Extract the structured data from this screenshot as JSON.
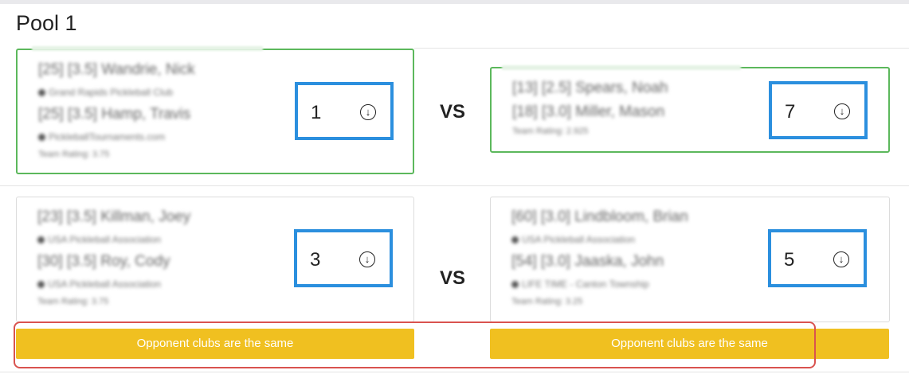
{
  "pool": {
    "title": "Pool 1"
  },
  "matches": [
    {
      "vs_label": "VS",
      "left": {
        "winner": true,
        "players": [
          {
            "name": "[25] [3.5] Wandrie, Nick",
            "club": "Grand Rapids Pickleball Club"
          },
          {
            "name": "[25] [3.5] Hamp, Travis",
            "club": "PickleballTournaments.com"
          }
        ],
        "rating": "Team Rating: 3.75",
        "seed": "1"
      },
      "right": {
        "winner": true,
        "players": [
          {
            "name": "[13] [2.5] Spears, Noah",
            "club": ""
          },
          {
            "name": "[18] [3.0] Miller, Mason",
            "club": ""
          }
        ],
        "rating": "Team Rating: 2.925",
        "seed": "7"
      }
    },
    {
      "vs_label": "VS",
      "left": {
        "winner": false,
        "players": [
          {
            "name": "[23] [3.5] Killman, Joey",
            "club": "USA Pickleball Association"
          },
          {
            "name": "[30] [3.5] Roy, Cody",
            "club": "USA Pickleball Association"
          }
        ],
        "rating": "Team Rating: 3.75",
        "seed": "3",
        "warning": "Opponent clubs are the same"
      },
      "right": {
        "winner": false,
        "players": [
          {
            "name": "[60] [3.0] Lindbloom, Brian",
            "club": "USA Pickleball Association"
          },
          {
            "name": "[54] [3.0] Jaaska, John",
            "club": "LIFE TIME - Canton Township"
          }
        ],
        "rating": "Team Rating: 3.25",
        "seed": "5",
        "warning": "Opponent clubs are the same"
      }
    }
  ],
  "icons": {
    "download": "arrow-circle-down-icon"
  },
  "colors": {
    "winner_border": "#5cb85c",
    "seed_border": "#2b8fde",
    "warning_bg": "#f0c020",
    "highlight": "#d9534f"
  }
}
